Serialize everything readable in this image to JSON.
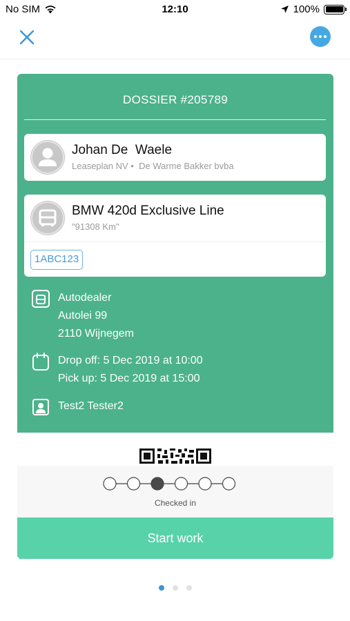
{
  "status_bar": {
    "carrier": "No SIM",
    "time": "12:10",
    "battery": "100%",
    "icons": [
      "wifi-icon",
      "location-arrow-icon",
      "battery-icon"
    ]
  },
  "nav": {
    "close_icon": "close-icon",
    "more_icon": "more-dots-icon",
    "accent_color": "#46a8e2"
  },
  "card": {
    "title": "DOSSIER #205789",
    "background_color": "#4cb28c",
    "customer": {
      "name": "Johan De  Waele",
      "company": "Leaseplan NV",
      "separator": "•",
      "employer": "De Warme Bakker bvba"
    },
    "vehicle": {
      "model": "BMW 420d Exclusive Line",
      "mileage": "\"91308 Km\"",
      "plate": "1ABC123"
    },
    "location": {
      "name": "Autodealer",
      "street": "Autolei 99",
      "city": "2110 Wijnegem"
    },
    "schedule": {
      "drop_off": "Drop off: 5 Dec 2019 at 10:00",
      "pick_up": "Pick up: 5 Dec 2019 at 15:00"
    },
    "assignee": "Test2 Tester2",
    "progress": {
      "total_steps": 6,
      "current_step": 3,
      "label": "Checked in"
    },
    "action_button": "Start work",
    "action_color": "#58d2a8"
  },
  "pager": {
    "pages": 3,
    "active": 1
  }
}
